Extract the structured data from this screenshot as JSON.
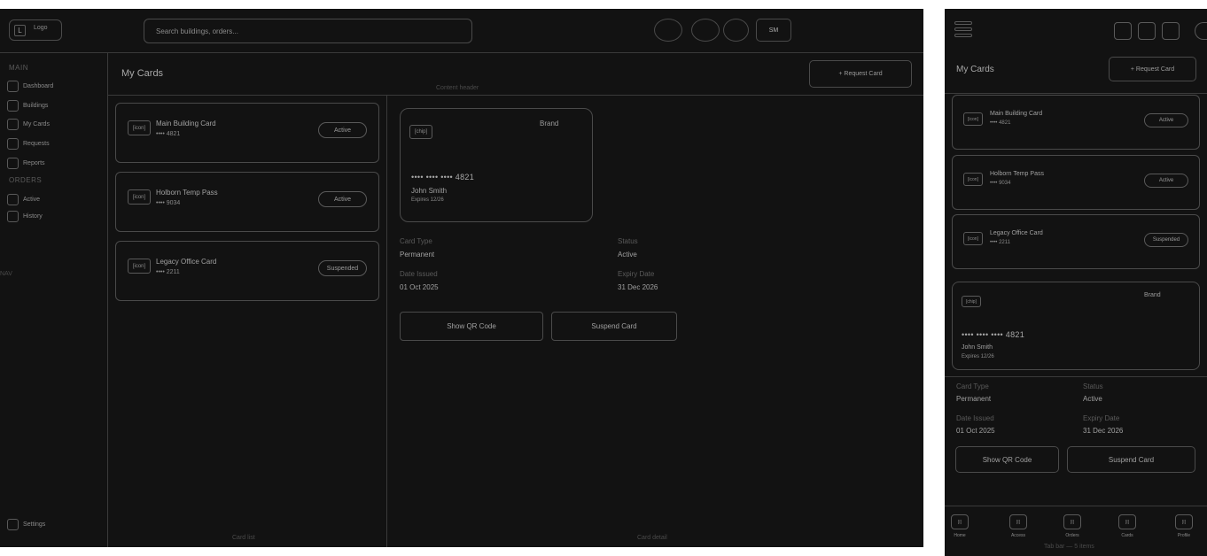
{
  "desktop": {
    "logo": {
      "mark": "L",
      "text": "Logo"
    },
    "search": {
      "placeholder": "Search buildings, orders..."
    },
    "avatar": "SM",
    "header_icons": [
      "notification-circle-icon",
      "message-circle-icon",
      "help-circle-icon"
    ],
    "sidebar": {
      "sections": [
        {
          "title": "MAIN",
          "items": [
            "Dashboard",
            "Buildings",
            "My Cards",
            "Requests",
            "Reports"
          ]
        },
        {
          "title": "ORDERS",
          "items": [
            "Active",
            "History"
          ]
        }
      ],
      "nav_note": "NAV",
      "settings": "Settings"
    },
    "content_header": {
      "title": "My Cards",
      "note": "Content header",
      "request_button": "+ Request Card"
    },
    "card_list": {
      "note": "Card list",
      "cards": [
        {
          "icon": "[icon]",
          "name": "Main Building Card",
          "number": "•••• 4821",
          "status": "Active"
        },
        {
          "icon": "[icon]",
          "name": "Holborn Temp Pass",
          "number": "•••• 9034",
          "status": "Active"
        },
        {
          "icon": "[icon]",
          "name": "Legacy Office Card",
          "number": "•••• 2211",
          "status": "Suspended"
        }
      ]
    },
    "detail": {
      "note": "Card detail",
      "card": {
        "chip": "[chip]",
        "brand": "Brand",
        "masked_number": "•••• •••• •••• 4821",
        "holder": "John Smith",
        "expires": "Expires 12/26"
      },
      "fields": [
        {
          "label": "Card Type",
          "value": "Permanent"
        },
        {
          "label": "Status",
          "value": "Active"
        },
        {
          "label": "Date Issued",
          "value": "01 Oct 2025"
        },
        {
          "label": "Expiry Date",
          "value": "31 Dec 2026"
        }
      ],
      "actions": {
        "qr": "Show QR Code",
        "suspend": "Suspend Card"
      }
    }
  },
  "mobile": {
    "title": "My Cards",
    "request_button": "+ Request Card",
    "cards": [
      {
        "icon": "[icon]",
        "name": "Main Building Card",
        "number": "•••• 4821",
        "status": "Active"
      },
      {
        "icon": "[icon]",
        "name": "Holborn Temp Pass",
        "number": "•••• 9034",
        "status": "Active"
      },
      {
        "icon": "[icon]",
        "name": "Legacy Office Card",
        "number": "•••• 2211",
        "status": "Suspended"
      }
    ],
    "card_visual": {
      "chip": "[chip]",
      "brand": "Brand",
      "masked_number": "•••• •••• •••• 4821",
      "holder": "John Smith",
      "expires": "Expires 12/26"
    },
    "fields": [
      {
        "label": "Card Type",
        "value": "Permanent"
      },
      {
        "label": "Status",
        "value": "Active"
      },
      {
        "label": "Date Issued",
        "value": "01 Oct 2025"
      },
      {
        "label": "Expiry Date",
        "value": "31 Dec 2026"
      }
    ],
    "actions": {
      "qr": "Show QR Code",
      "suspend": "Suspend Card"
    },
    "tabbar": {
      "note": "Tab bar — 5 items",
      "tabs": [
        {
          "icon": "[i]",
          "label": "Home"
        },
        {
          "icon": "[i]",
          "label": "Access"
        },
        {
          "icon": "[i]",
          "label": "Orders"
        },
        {
          "icon": "[i]",
          "label": "Cards"
        },
        {
          "icon": "[i]",
          "label": "Profile"
        }
      ]
    }
  },
  "colors": {
    "background": "#121212",
    "border": "#4a4a4a",
    "text": "#a8a8a8",
    "muted": "#5a5a5a"
  }
}
